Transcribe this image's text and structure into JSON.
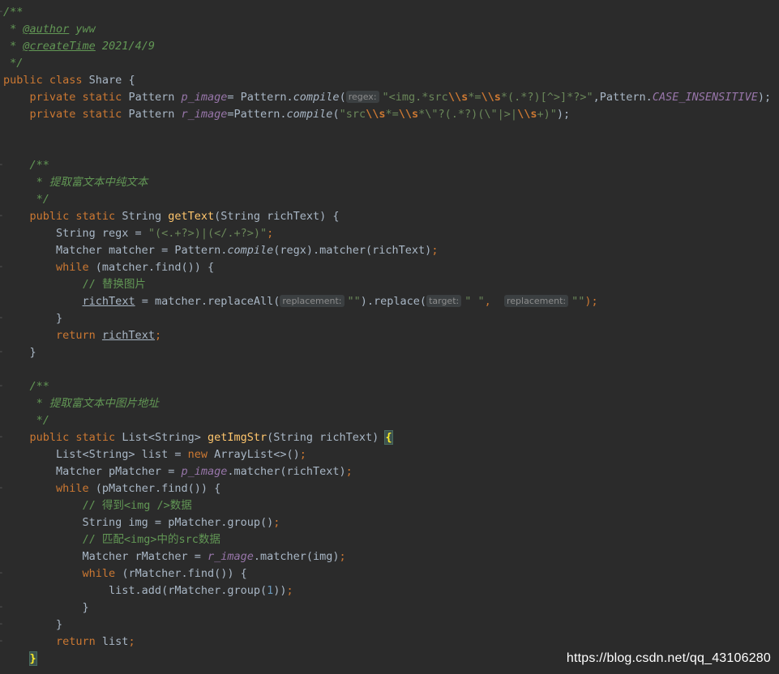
{
  "editor": {
    "lines": [
      {
        "segments": [
          {
            "t": "/**",
            "c": "doc"
          }
        ]
      },
      {
        "segments": [
          {
            "t": " * ",
            "c": "doc"
          },
          {
            "t": "@author",
            "c": "doctag"
          },
          {
            "t": " yww",
            "c": "doc"
          }
        ]
      },
      {
        "segments": [
          {
            "t": " * ",
            "c": "doc"
          },
          {
            "t": "@createTime",
            "c": "doctag"
          },
          {
            "t": " 2021/4/9",
            "c": "doc"
          }
        ]
      },
      {
        "segments": [
          {
            "t": " */",
            "c": "doc"
          }
        ]
      },
      {
        "segments": [
          {
            "t": "public class ",
            "c": "kw"
          },
          {
            "t": "Share {",
            "c": ""
          }
        ]
      },
      {
        "segments": [
          {
            "t": "    private static ",
            "c": "kw"
          },
          {
            "t": "Pattern ",
            "c": ""
          },
          {
            "t": "p_image",
            "c": "field"
          },
          {
            "t": "= Pattern.",
            "c": ""
          },
          {
            "t": "compile",
            "c": "method-i"
          },
          {
            "t": "(",
            "c": ""
          },
          {
            "t": "regex:",
            "c": "hint"
          },
          {
            "t": "\"<img.*src",
            "c": "str"
          },
          {
            "t": "\\\\s",
            "c": "esc"
          },
          {
            "t": "*=",
            "c": "str"
          },
          {
            "t": "\\\\s",
            "c": "esc"
          },
          {
            "t": "*(.*?)[^>]*?>\"",
            "c": "str"
          },
          {
            "t": ",Pattern.",
            "c": ""
          },
          {
            "t": "CASE_INSENSITIVE",
            "c": "field"
          },
          {
            "t": ");",
            "c": ""
          }
        ]
      },
      {
        "segments": [
          {
            "t": "    private static ",
            "c": "kw"
          },
          {
            "t": "Pattern ",
            "c": ""
          },
          {
            "t": "r_image",
            "c": "field"
          },
          {
            "t": "=Pattern.",
            "c": ""
          },
          {
            "t": "compile",
            "c": "method-i"
          },
          {
            "t": "(",
            "c": ""
          },
          {
            "t": "\"src",
            "c": "str"
          },
          {
            "t": "\\\\s",
            "c": "esc"
          },
          {
            "t": "*=",
            "c": "str"
          },
          {
            "t": "\\\\s",
            "c": "esc"
          },
          {
            "t": "*\\\"?(.*?)(\\\"|>|",
            "c": "str"
          },
          {
            "t": "\\\\s",
            "c": "esc"
          },
          {
            "t": "+)\"",
            "c": "str"
          },
          {
            "t": ");",
            "c": ""
          }
        ]
      },
      {
        "segments": []
      },
      {
        "segments": []
      },
      {
        "segments": [
          {
            "t": "    /**",
            "c": "doc"
          }
        ]
      },
      {
        "segments": [
          {
            "t": "     * 提取富文本中纯文本",
            "c": "doc"
          }
        ]
      },
      {
        "segments": [
          {
            "t": "     */",
            "c": "doc"
          }
        ]
      },
      {
        "segments": [
          {
            "t": "    public static ",
            "c": "kw"
          },
          {
            "t": "String ",
            "c": ""
          },
          {
            "t": "getText",
            "c": "method"
          },
          {
            "t": "(String richText) {",
            "c": ""
          }
        ]
      },
      {
        "segments": [
          {
            "t": "        String regx = ",
            "c": ""
          },
          {
            "t": "\"(<.+?>)|(</.+?>)\"",
            "c": "str"
          },
          {
            "t": ";",
            "c": "kw"
          }
        ]
      },
      {
        "segments": [
          {
            "t": "        Matcher matcher = Pattern.",
            "c": ""
          },
          {
            "t": "compile",
            "c": "method-i"
          },
          {
            "t": "(regx).matcher(richText)",
            "c": ""
          },
          {
            "t": ";",
            "c": "kw"
          }
        ]
      },
      {
        "segments": [
          {
            "t": "        while ",
            "c": "kw"
          },
          {
            "t": "(matcher.find()) {",
            "c": ""
          }
        ]
      },
      {
        "segments": [
          {
            "t": "            // 替换图片",
            "c": "lc"
          }
        ]
      },
      {
        "segments": [
          {
            "t": "            ",
            "c": ""
          },
          {
            "t": "richText",
            "c": "local"
          },
          {
            "t": " = matcher.replaceAll(",
            "c": ""
          },
          {
            "t": "replacement:",
            "c": "hint"
          },
          {
            "t": "\"\"",
            "c": "str"
          },
          {
            "t": ").replace(",
            "c": ""
          },
          {
            "t": "target:",
            "c": "hint"
          },
          {
            "t": "\" \"",
            "c": "str"
          },
          {
            "t": ",  ",
            "c": "kw"
          },
          {
            "t": "replacement:",
            "c": "hint"
          },
          {
            "t": "\"\"",
            "c": "str"
          },
          {
            "t": ");",
            "c": "kw"
          }
        ]
      },
      {
        "segments": [
          {
            "t": "        }",
            "c": ""
          }
        ]
      },
      {
        "segments": [
          {
            "t": "        return ",
            "c": "kw"
          },
          {
            "t": "richText",
            "c": "local"
          },
          {
            "t": ";",
            "c": "kw"
          }
        ]
      },
      {
        "segments": [
          {
            "t": "    }",
            "c": ""
          }
        ]
      },
      {
        "segments": []
      },
      {
        "segments": [
          {
            "t": "    /**",
            "c": "doc"
          }
        ]
      },
      {
        "segments": [
          {
            "t": "     * 提取富文本中图片地址",
            "c": "doc"
          }
        ]
      },
      {
        "segments": [
          {
            "t": "     */",
            "c": "doc"
          }
        ]
      },
      {
        "segments": [
          {
            "t": "    public static ",
            "c": "kw"
          },
          {
            "t": "List<String> ",
            "c": ""
          },
          {
            "t": "getImgStr",
            "c": "method"
          },
          {
            "t": "(String richText) ",
            "c": ""
          },
          {
            "t": "{",
            "c": "brace"
          }
        ]
      },
      {
        "segments": [
          {
            "t": "        List<String> list = ",
            "c": ""
          },
          {
            "t": "new ",
            "c": "kw"
          },
          {
            "t": "ArrayList<>()",
            "c": ""
          },
          {
            "t": ";",
            "c": "kw"
          }
        ]
      },
      {
        "segments": [
          {
            "t": "        Matcher pMatcher = ",
            "c": ""
          },
          {
            "t": "p_image",
            "c": "field"
          },
          {
            "t": ".matcher(richText)",
            "c": ""
          },
          {
            "t": ";",
            "c": "kw"
          }
        ]
      },
      {
        "segments": [
          {
            "t": "        while ",
            "c": "kw"
          },
          {
            "t": "(pMatcher.find()) {",
            "c": ""
          }
        ]
      },
      {
        "segments": [
          {
            "t": "            // 得到<img />数据",
            "c": "lc"
          }
        ]
      },
      {
        "segments": [
          {
            "t": "            String img = pMatcher.group()",
            "c": ""
          },
          {
            "t": ";",
            "c": "kw"
          }
        ]
      },
      {
        "segments": [
          {
            "t": "            // 匹配<img>中的src数据",
            "c": "lc"
          }
        ]
      },
      {
        "segments": [
          {
            "t": "            Matcher rMatcher = ",
            "c": ""
          },
          {
            "t": "r_image",
            "c": "field"
          },
          {
            "t": ".matcher(img)",
            "c": ""
          },
          {
            "t": ";",
            "c": "kw"
          }
        ]
      },
      {
        "segments": [
          {
            "t": "            while ",
            "c": "kw"
          },
          {
            "t": "(rMatcher.find()) {",
            "c": ""
          }
        ]
      },
      {
        "segments": [
          {
            "t": "                list.add(rMatcher.group(",
            "c": ""
          },
          {
            "t": "1",
            "c": "num"
          },
          {
            "t": "))",
            "c": ""
          },
          {
            "t": ";",
            "c": "kw"
          }
        ]
      },
      {
        "segments": [
          {
            "t": "            }",
            "c": ""
          }
        ]
      },
      {
        "segments": [
          {
            "t": "        }",
            "c": ""
          }
        ]
      },
      {
        "segments": [
          {
            "t": "        return ",
            "c": "kw"
          },
          {
            "t": "list",
            "c": ""
          },
          {
            "t": ";",
            "c": "kw"
          }
        ]
      },
      {
        "segments": [
          {
            "t": "    ",
            "c": ""
          },
          {
            "t": "}",
            "c": "brace"
          }
        ]
      }
    ],
    "fold_marks": [
      0,
      9,
      12,
      15,
      18,
      20,
      22,
      25,
      28,
      33,
      35,
      36,
      37
    ]
  },
  "watermark": {
    "text": "https://blog.csdn.net/qq_43106280"
  },
  "colors": {
    "background": "#2b2b2b",
    "keyword": "#cc7832",
    "doc_comment": "#629755",
    "line_comment": "#808080",
    "field": "#9876aa",
    "method": "#ffc66d",
    "string": "#6a8759",
    "number": "#6897bb",
    "text": "#a9b7c6"
  }
}
